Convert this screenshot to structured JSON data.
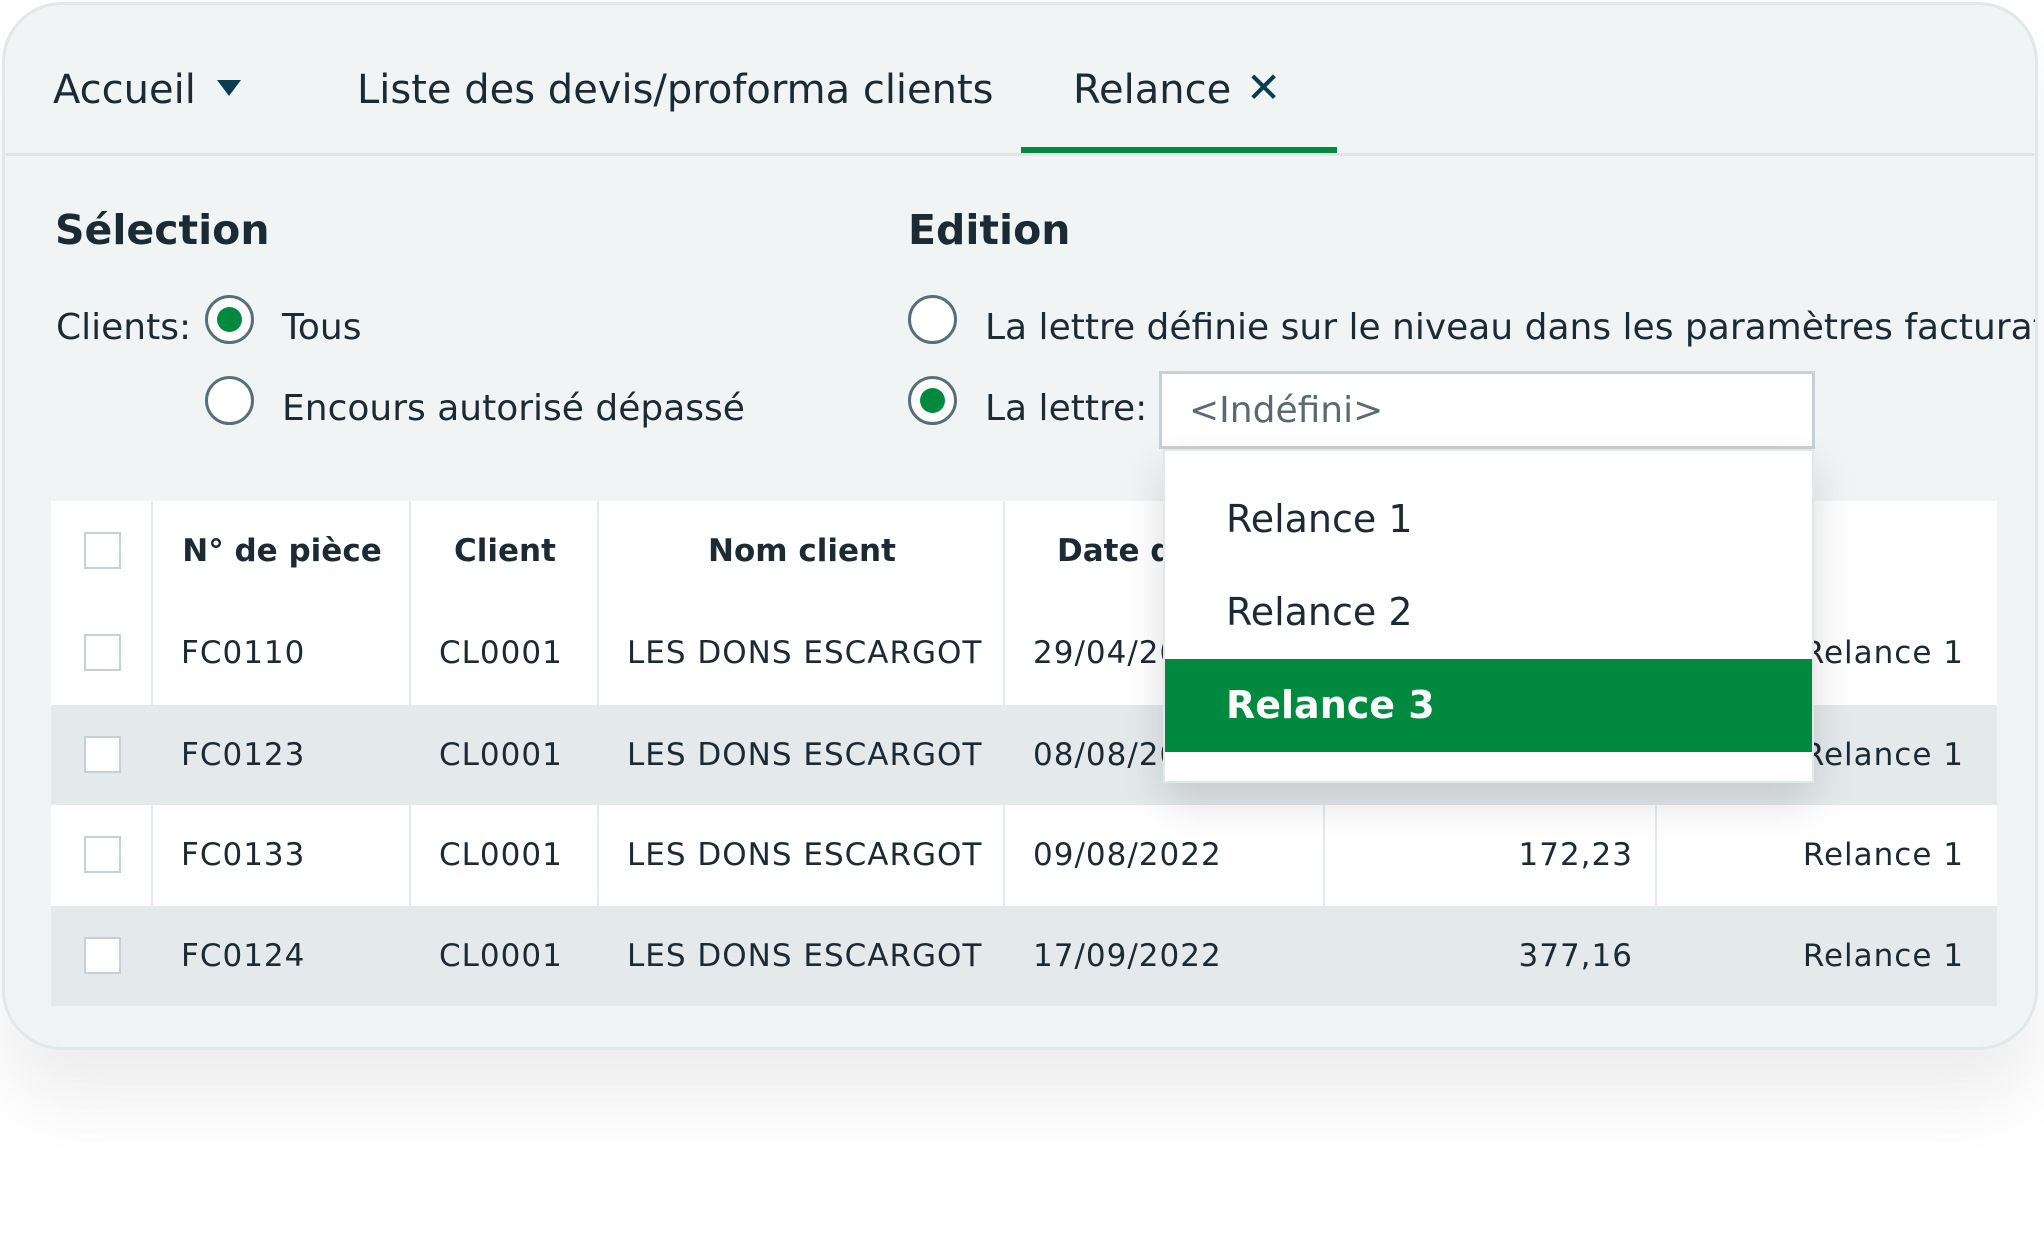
{
  "tabs": [
    {
      "label": "Accueil",
      "icon": "caret-down-icon"
    },
    {
      "label": "Liste des devis/proforma clients"
    },
    {
      "label": "Relance",
      "icon": "close-icon",
      "active": true
    }
  ],
  "selection": {
    "title": "Sélection",
    "clients_label": "Clients:",
    "options": [
      {
        "label": "Tous",
        "checked": true
      },
      {
        "label": "Encours autorisé dépassé",
        "checked": false
      }
    ]
  },
  "edition": {
    "title": "Edition",
    "options": [
      {
        "label": "La lettre définie sur le niveau dans les paramètres facturation",
        "checked": false
      },
      {
        "label": "La lettre:",
        "checked": true
      }
    ],
    "select_value": "<Indéfini>",
    "dropdown_options": [
      "Relance 1",
      "Relance 2",
      "Relance 3"
    ],
    "dropdown_selected": "Relance 3"
  },
  "table": {
    "headers": [
      "N° de pièce",
      "Client",
      "Nom client",
      "Date d’"
    ],
    "rows": [
      {
        "piece": "FC0110",
        "client": "CL0001",
        "nom": "LES DONS ESCARGOT",
        "date": "29/04/20",
        "montant": "",
        "niveau": "Relance 1"
      },
      {
        "piece": "FC0123",
        "client": "CL0001",
        "nom": "LES DONS ESCARGOT",
        "date": "08/08/20",
        "montant": "",
        "niveau": "Relance 1"
      },
      {
        "piece": "FC0133",
        "client": "CL0001",
        "nom": "LES DONS ESCARGOT",
        "date": "09/08/2022",
        "montant": "172,23",
        "niveau": "Relance 1"
      },
      {
        "piece": "FC0124",
        "client": "CL0001",
        "nom": "LES DONS ESCARGOT",
        "date": "17/09/2022",
        "montant": "377,16",
        "niveau": "Relance 1"
      }
    ]
  },
  "colors": {
    "accent": "#00893f",
    "icon": "#0b3d52",
    "alt_row": "#e4e9ec"
  }
}
